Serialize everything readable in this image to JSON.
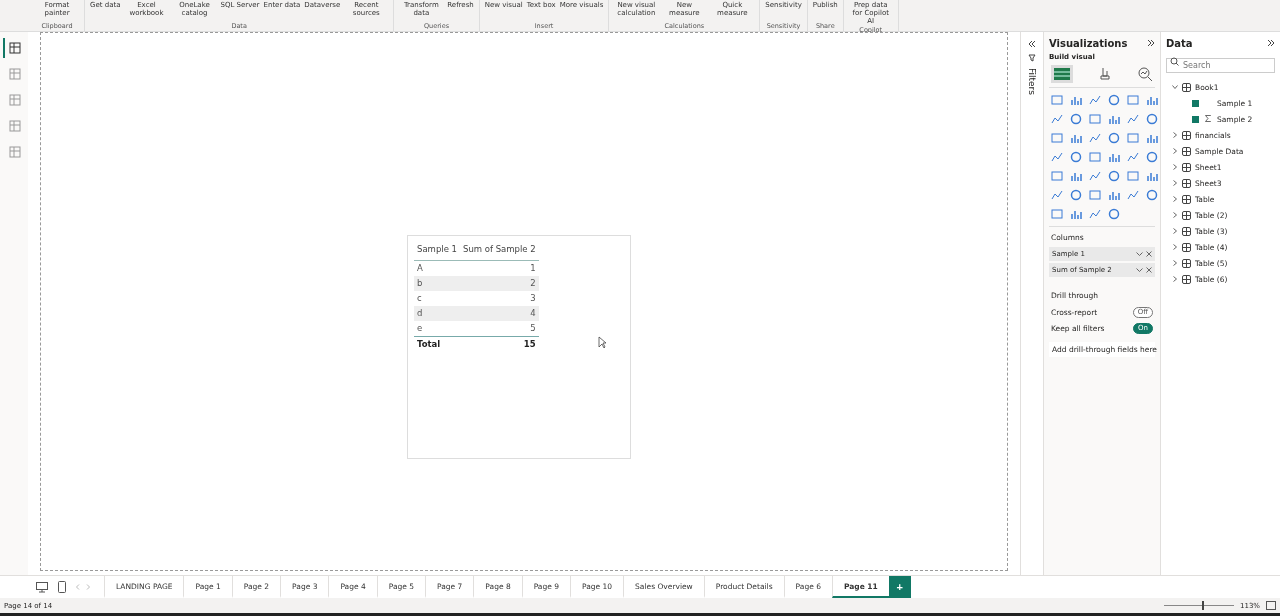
{
  "ribbon": {
    "groups": [
      {
        "label": "Clipboard",
        "buttons": [
          "Format painter"
        ]
      },
      {
        "label": "Data",
        "buttons": [
          "Get data",
          "Excel workbook",
          "OneLake catalog",
          "SQL Server",
          "Enter data",
          "Dataverse",
          "Recent sources"
        ]
      },
      {
        "label": "Queries",
        "buttons": [
          "Transform data",
          "Refresh"
        ]
      },
      {
        "label": "Insert",
        "buttons": [
          "New visual",
          "Text box",
          "More visuals"
        ]
      },
      {
        "label": "Calculations",
        "buttons": [
          "New visual calculation",
          "New measure",
          "Quick measure"
        ]
      },
      {
        "label": "Sensitivity",
        "buttons": [
          "Sensitivity"
        ]
      },
      {
        "label": "Share",
        "buttons": [
          "Publish"
        ]
      },
      {
        "label": "Copilot",
        "buttons": [
          "Prep data for Copilot AI"
        ]
      }
    ]
  },
  "left_nav": [
    {
      "selected": true
    },
    {
      "selected": false
    },
    {
      "selected": false
    },
    {
      "selected": false
    },
    {
      "selected": false
    }
  ],
  "table_visual": {
    "columns": [
      "Sample 1",
      "Sum of Sample 2"
    ],
    "rows": [
      [
        "A",
        "1"
      ],
      [
        "b",
        "2"
      ],
      [
        "c",
        "3"
      ],
      [
        "d",
        "4"
      ],
      [
        "e",
        "5"
      ]
    ],
    "total": [
      "Total",
      "15"
    ]
  },
  "filters": {
    "label": "Filters"
  },
  "visualizations": {
    "title": "Visualizations",
    "subtitle": "Build visual",
    "columns_label": "Columns",
    "fields": [
      "Sample 1",
      "Sum of Sample 2"
    ],
    "drill_label": "Drill through",
    "toggles": [
      {
        "label": "Cross-report",
        "on": false,
        "state_text": "Off"
      },
      {
        "label": "Keep all filters",
        "on": true,
        "state_text": "On"
      }
    ],
    "drop_hint": "Add drill-through fields here"
  },
  "data": {
    "title": "Data",
    "search": {
      "placeholder": "Search"
    },
    "tree": [
      {
        "label": "Book1",
        "expanded": true,
        "children": [
          {
            "label": "Sample 1",
            "checked": true,
            "kind": "column"
          },
          {
            "label": "Sample 2",
            "checked": true,
            "kind": "sum"
          }
        ]
      },
      {
        "label": "financials",
        "expanded": false
      },
      {
        "label": "Sample Data",
        "expanded": false
      },
      {
        "label": "Sheet1",
        "expanded": false
      },
      {
        "label": "Sheet3",
        "expanded": false
      },
      {
        "label": "Table",
        "expanded": false
      },
      {
        "label": "Table (2)",
        "expanded": false
      },
      {
        "label": "Table (3)",
        "expanded": false
      },
      {
        "label": "Table (4)",
        "expanded": false
      },
      {
        "label": "Table (5)",
        "expanded": false
      },
      {
        "label": "Table (6)",
        "expanded": false
      }
    ]
  },
  "page_tabs": [
    {
      "label": "LANDING PAGE",
      "selected": false
    },
    {
      "label": "Page 1",
      "selected": false
    },
    {
      "label": "Page 2",
      "selected": false
    },
    {
      "label": "Page 3",
      "selected": false
    },
    {
      "label": "Page 4",
      "selected": false
    },
    {
      "label": "Page 5",
      "selected": false
    },
    {
      "label": "Page 7",
      "selected": false
    },
    {
      "label": "Page 8",
      "selected": false
    },
    {
      "label": "Page 9",
      "selected": false
    },
    {
      "label": "Page 10",
      "selected": false
    },
    {
      "label": "Sales Overview",
      "selected": false
    },
    {
      "label": "Product Details",
      "selected": false
    },
    {
      "label": "Page 6",
      "selected": false
    },
    {
      "label": "Page 11",
      "selected": true
    }
  ],
  "add_page": "+",
  "status_bar": {
    "page": "Page 14 of 14",
    "zoom": "113%",
    "level": 0.55
  }
}
